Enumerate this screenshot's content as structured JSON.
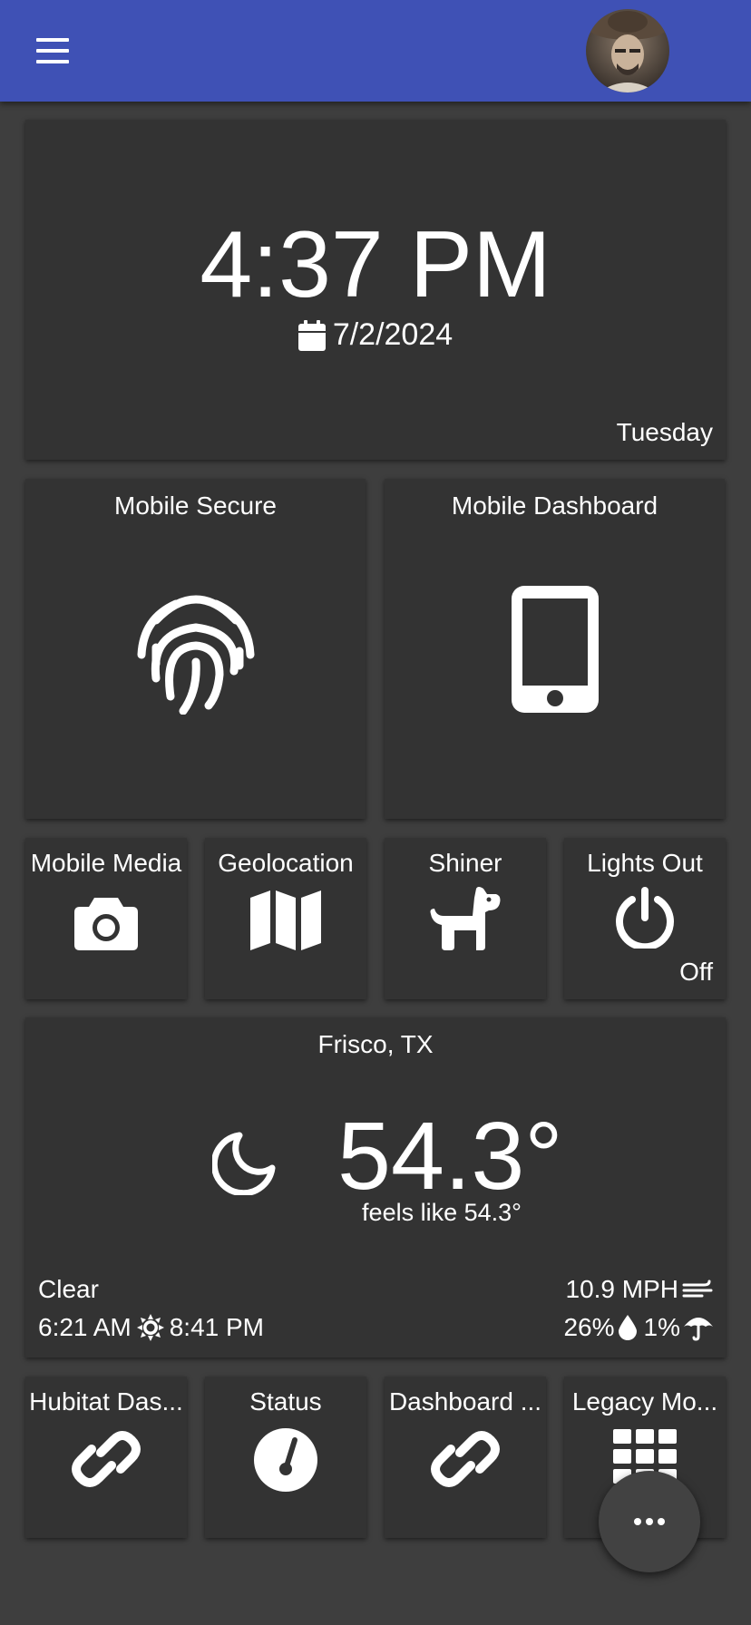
{
  "header": {
    "menu_icon": "menu-icon",
    "avatar": "user-avatar",
    "color": "#3f51b5"
  },
  "clock": {
    "time": "4:37 PM",
    "date": "7/2/2024",
    "day": "Tuesday",
    "date_icon": "calendar-icon"
  },
  "tiles": {
    "mobile_secure": {
      "label": "Mobile Secure",
      "icon": "fingerprint-icon"
    },
    "mobile_dashboard": {
      "label": "Mobile Dashboard",
      "icon": "smartphone-icon"
    },
    "mobile_media": {
      "label": "Mobile Media",
      "icon": "camera-icon"
    },
    "geolocation": {
      "label": "Geolocation",
      "icon": "map-icon"
    },
    "shiner": {
      "label": "Shiner",
      "icon": "dog-icon"
    },
    "lights_out": {
      "label": "Lights Out",
      "icon": "power-icon",
      "state": "Off"
    },
    "hubitat": {
      "label": "Hubitat Das...",
      "icon": "link-icon"
    },
    "status": {
      "label": "Status",
      "icon": "gauge-icon"
    },
    "dashboard": {
      "label": "Dashboard ...",
      "icon": "link-icon"
    },
    "legacy": {
      "label": "Legacy Mo...",
      "icon": "keypad-icon"
    }
  },
  "weather": {
    "location": "Frisco, TX",
    "temperature": "54.3°",
    "feels_like": "feels like 54.3°",
    "condition": "Clear",
    "sunrise": "6:21 AM",
    "sunset": "8:41 PM",
    "wind": "10.9 MPH",
    "humidity": "26%",
    "precip_chance": "1%",
    "condition_icon": "moon-icon"
  },
  "fab": {
    "icon": "more-horizontal-icon"
  }
}
